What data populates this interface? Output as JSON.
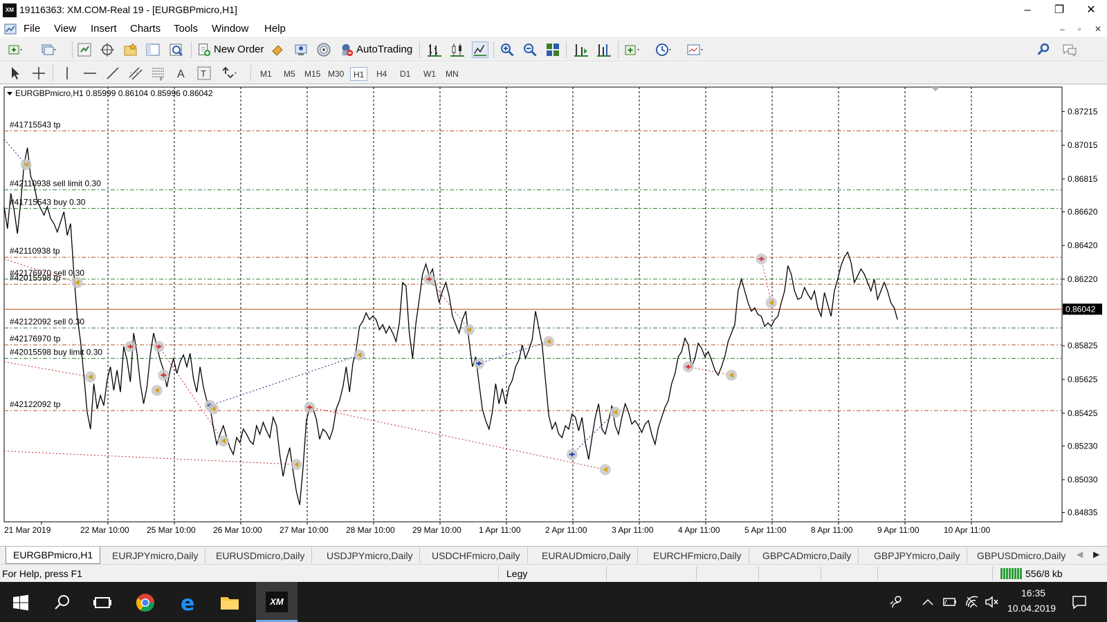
{
  "window": {
    "title": "19116363: XM.COM-Real 19 - [EURGBPmicro,H1]",
    "logo_text": "XM",
    "minimize": "–",
    "maximize": "❐",
    "close": "✕"
  },
  "menu": {
    "items": [
      "File",
      "View",
      "Insert",
      "Charts",
      "Tools",
      "Window",
      "Help"
    ],
    "mdi_min": "–",
    "mdi_restore": "▫",
    "mdi_close": "✕"
  },
  "toolbar": {
    "new_order": "New Order",
    "autotrading": "AutoTrading"
  },
  "timeframes": [
    "M1",
    "M5",
    "M15",
    "M30",
    "H1",
    "H4",
    "D1",
    "W1",
    "MN"
  ],
  "active_timeframe": "H1",
  "chart_data": {
    "type": "line",
    "symbol_info": "EURGBPmicro,H1  0.85999 0.86104 0.85996 0.86042",
    "current_price": "0.86042",
    "price_labels": [
      "0.87215",
      "0.87015",
      "0.86815",
      "0.86620",
      "0.86420",
      "0.86220",
      "0.86025",
      "0.85825",
      "0.85625",
      "0.85425",
      "0.85230",
      "0.85030",
      "0.84835"
    ],
    "time_labels": [
      "21 Mar 2019",
      "22 Mar 10:00",
      "25 Mar 10:00",
      "26 Mar 10:00",
      "27 Mar 10:00",
      "28 Mar 10:00",
      "29 Mar 10:00",
      "1 Apr 11:00",
      "2 Apr 11:00",
      "3 Apr 11:00",
      "4 Apr 11:00",
      "5 Apr 11:00",
      "8 Apr 11:00",
      "9 Apr 11:00",
      "10 Apr 11:00"
    ],
    "ylim": [
      0.8478,
      0.8736
    ],
    "order_lines": [
      {
        "label": "#41715543 tp",
        "price": 0.871,
        "color": "#b8501e",
        "kind": "tp"
      },
      {
        "label": "#42110938 sell limit 0.30",
        "price": 0.8675,
        "color": "#2e7d32",
        "kind": "order"
      },
      {
        "label": "#41715543 buy 0.30",
        "price": 0.8664,
        "color": "#2e7d32",
        "kind": "order"
      },
      {
        "label": "#42110938 tp",
        "price": 0.8635,
        "color": "#b8501e",
        "kind": "tp"
      },
      {
        "label": "#42176970 sell 0.30",
        "price": 0.8622,
        "color": "#2e7d32",
        "kind": "order"
      },
      {
        "label": "#42015598 tp",
        "price": 0.8619,
        "color": "#b8501e",
        "kind": "tp"
      },
      {
        "label": "#42122092 sell 0.30",
        "price": 0.8593,
        "color": "#2e7d32",
        "kind": "order"
      },
      {
        "label": "#42176970 tp",
        "price": 0.8583,
        "color": "#b8501e",
        "kind": "tp"
      },
      {
        "label": "#42015598 buy limit 0.30",
        "price": 0.8575,
        "color": "#2e7d32",
        "kind": "order"
      },
      {
        "label": "#42122092 tp",
        "price": 0.8544,
        "color": "#b8501e",
        "kind": "tp"
      }
    ],
    "price_series": [
      [
        0,
        0.8665
      ],
      [
        0.05,
        0.8652
      ],
      [
        0.1,
        0.8673
      ],
      [
        0.15,
        0.8663
      ],
      [
        0.2,
        0.8649
      ],
      [
        0.25,
        0.8668
      ],
      [
        0.3,
        0.869
      ],
      [
        0.35,
        0.87
      ],
      [
        0.4,
        0.8683
      ],
      [
        0.45,
        0.8678
      ],
      [
        0.5,
        0.8668
      ],
      [
        0.55,
        0.8664
      ],
      [
        0.6,
        0.866
      ],
      [
        0.65,
        0.8665
      ],
      [
        0.7,
        0.8658
      ],
      [
        0.75,
        0.8655
      ],
      [
        0.8,
        0.865
      ],
      [
        0.85,
        0.8656
      ],
      [
        0.9,
        0.8662
      ],
      [
        0.95,
        0.8648
      ],
      [
        1.0,
        0.8655
      ],
      [
        1.05,
        0.8625
      ],
      [
        1.1,
        0.86
      ],
      [
        1.15,
        0.8585
      ],
      [
        1.2,
        0.8565
      ],
      [
        1.25,
        0.8543
      ],
      [
        1.3,
        0.8533
      ],
      [
        1.35,
        0.856
      ],
      [
        1.4,
        0.8545
      ],
      [
        1.45,
        0.8553
      ],
      [
        1.5,
        0.8547
      ],
      [
        1.55,
        0.8562
      ],
      [
        1.6,
        0.857
      ],
      [
        1.65,
        0.8556
      ],
      [
        1.7,
        0.8568
      ],
      [
        1.75,
        0.8555
      ],
      [
        1.8,
        0.8582
      ],
      [
        1.85,
        0.8574
      ],
      [
        1.9,
        0.8561
      ],
      [
        1.95,
        0.859
      ],
      [
        2.0,
        0.8578
      ],
      [
        2.05,
        0.856
      ],
      [
        2.1,
        0.8548
      ],
      [
        2.15,
        0.8558
      ],
      [
        2.2,
        0.8577
      ],
      [
        2.25,
        0.859
      ],
      [
        2.3,
        0.8582
      ],
      [
        2.35,
        0.8574
      ],
      [
        2.4,
        0.8568
      ],
      [
        2.45,
        0.8558
      ],
      [
        2.5,
        0.8568
      ],
      [
        2.55,
        0.8575
      ],
      [
        2.6,
        0.8566
      ],
      [
        2.65,
        0.8573
      ],
      [
        2.7,
        0.8577
      ],
      [
        2.75,
        0.857
      ],
      [
        2.8,
        0.8578
      ],
      [
        2.85,
        0.8563
      ],
      [
        2.9,
        0.8555
      ],
      [
        2.95,
        0.857
      ],
      [
        3.0,
        0.8558
      ],
      [
        3.05,
        0.855
      ],
      [
        3.1,
        0.8546
      ],
      [
        3.15,
        0.8534
      ],
      [
        3.2,
        0.8524
      ],
      [
        3.25,
        0.853
      ],
      [
        3.3,
        0.8535
      ],
      [
        3.35,
        0.8528
      ],
      [
        3.4,
        0.8522
      ],
      [
        3.45,
        0.8518
      ],
      [
        3.5,
        0.8528
      ],
      [
        3.55,
        0.8525
      ],
      [
        3.6,
        0.8533
      ],
      [
        3.65,
        0.853
      ],
      [
        3.7,
        0.8526
      ],
      [
        3.75,
        0.8524
      ],
      [
        3.8,
        0.8535
      ],
      [
        3.85,
        0.853
      ],
      [
        3.9,
        0.8537
      ],
      [
        3.95,
        0.8532
      ],
      [
        4.0,
        0.8528
      ],
      [
        4.05,
        0.854
      ],
      [
        4.1,
        0.8535
      ],
      [
        4.15,
        0.8518
      ],
      [
        4.2,
        0.8505
      ],
      [
        4.25,
        0.8515
      ],
      [
        4.3,
        0.8522
      ],
      [
        4.35,
        0.8508
      ],
      [
        4.4,
        0.8496
      ],
      [
        4.45,
        0.8488
      ],
      [
        4.5,
        0.851
      ],
      [
        4.55,
        0.8538
      ],
      [
        4.6,
        0.8546
      ],
      [
        4.65,
        0.8545
      ],
      [
        4.7,
        0.8539
      ],
      [
        4.75,
        0.8527
      ],
      [
        4.8,
        0.8533
      ],
      [
        4.85,
        0.8531
      ],
      [
        4.9,
        0.8527
      ],
      [
        4.95,
        0.8533
      ],
      [
        5.0,
        0.8545
      ],
      [
        5.05,
        0.855
      ],
      [
        5.1,
        0.8558
      ],
      [
        5.15,
        0.857
      ],
      [
        5.2,
        0.8555
      ],
      [
        5.25,
        0.8572
      ],
      [
        5.3,
        0.858
      ],
      [
        5.35,
        0.8594
      ],
      [
        5.4,
        0.8597
      ],
      [
        5.45,
        0.8602
      ],
      [
        5.5,
        0.8598
      ],
      [
        5.55,
        0.86
      ],
      [
        5.6,
        0.8598
      ],
      [
        5.65,
        0.8592
      ],
      [
        5.7,
        0.8595
      ],
      [
        5.75,
        0.859
      ],
      [
        5.8,
        0.8594
      ],
      [
        5.85,
        0.859
      ],
      [
        5.9,
        0.8585
      ],
      [
        5.95,
        0.8596
      ],
      [
        6.0,
        0.862
      ],
      [
        6.05,
        0.8618
      ],
      [
        6.1,
        0.859
      ],
      [
        6.15,
        0.8575
      ],
      [
        6.2,
        0.8596
      ],
      [
        6.25,
        0.861
      ],
      [
        6.3,
        0.8625
      ],
      [
        6.35,
        0.8631
      ],
      [
        6.4,
        0.8624
      ],
      [
        6.45,
        0.8628
      ],
      [
        6.5,
        0.8618
      ],
      [
        6.55,
        0.8608
      ],
      [
        6.6,
        0.8615
      ],
      [
        6.65,
        0.862
      ],
      [
        6.7,
        0.8612
      ],
      [
        6.75,
        0.86
      ],
      [
        6.8,
        0.8595
      ],
      [
        6.85,
        0.859
      ],
      [
        6.9,
        0.8598
      ],
      [
        6.95,
        0.8603
      ],
      [
        7.0,
        0.8585
      ],
      [
        7.05,
        0.857
      ],
      [
        7.1,
        0.8576
      ],
      [
        7.15,
        0.856
      ],
      [
        7.2,
        0.8545
      ],
      [
        7.25,
        0.8538
      ],
      [
        7.3,
        0.8533
      ],
      [
        7.35,
        0.8543
      ],
      [
        7.4,
        0.856
      ],
      [
        7.45,
        0.8548
      ],
      [
        7.5,
        0.8557
      ],
      [
        7.55,
        0.8548
      ],
      [
        7.6,
        0.8558
      ],
      [
        7.65,
        0.8562
      ],
      [
        7.7,
        0.857
      ],
      [
        7.75,
        0.8574
      ],
      [
        7.8,
        0.8583
      ],
      [
        7.85,
        0.8575
      ],
      [
        7.9,
        0.858
      ],
      [
        7.95,
        0.8586
      ],
      [
        8.0,
        0.8603
      ],
      [
        8.05,
        0.8593
      ],
      [
        8.1,
        0.8583
      ],
      [
        8.15,
        0.8562
      ],
      [
        8.2,
        0.8541
      ],
      [
        8.25,
        0.8533
      ],
      [
        8.3,
        0.8537
      ],
      [
        8.35,
        0.853
      ],
      [
        8.4,
        0.8528
      ],
      [
        8.45,
        0.8535
      ],
      [
        8.5,
        0.8533
      ],
      [
        8.55,
        0.8542
      ],
      [
        8.6,
        0.854
      ],
      [
        8.65,
        0.8532
      ],
      [
        8.7,
        0.854
      ],
      [
        8.75,
        0.8525
      ],
      [
        8.8,
        0.8515
      ],
      [
        8.85,
        0.8528
      ],
      [
        8.9,
        0.854
      ],
      [
        8.95,
        0.8548
      ],
      [
        9.0,
        0.8533
      ],
      [
        9.05,
        0.853
      ],
      [
        9.1,
        0.8538
      ],
      [
        9.15,
        0.8547
      ],
      [
        9.2,
        0.8535
      ],
      [
        9.25,
        0.853
      ],
      [
        9.3,
        0.854
      ],
      [
        9.35,
        0.8548
      ],
      [
        9.4,
        0.8543
      ],
      [
        9.45,
        0.8536
      ],
      [
        9.5,
        0.8538
      ],
      [
        9.55,
        0.8535
      ],
      [
        9.6,
        0.8531
      ],
      [
        9.65,
        0.8536
      ],
      [
        9.7,
        0.8538
      ],
      [
        9.75,
        0.853
      ],
      [
        9.8,
        0.8524
      ],
      [
        9.85,
        0.8534
      ],
      [
        9.9,
        0.854
      ],
      [
        9.95,
        0.8546
      ],
      [
        10.0,
        0.855
      ],
      [
        10.05,
        0.856
      ],
      [
        10.1,
        0.8566
      ],
      [
        10.15,
        0.8576
      ],
      [
        10.2,
        0.8579
      ],
      [
        10.25,
        0.8587
      ],
      [
        10.3,
        0.8583
      ],
      [
        10.35,
        0.857
      ],
      [
        10.4,
        0.8575
      ],
      [
        10.45,
        0.8584
      ],
      [
        10.5,
        0.8581
      ],
      [
        10.55,
        0.8576
      ],
      [
        10.6,
        0.8579
      ],
      [
        10.65,
        0.8574
      ],
      [
        10.7,
        0.8568
      ],
      [
        10.75,
        0.8565
      ],
      [
        10.8,
        0.857
      ],
      [
        10.85,
        0.8576
      ],
      [
        10.9,
        0.8585
      ],
      [
        10.95,
        0.859
      ],
      [
        11.0,
        0.8595
      ],
      [
        11.05,
        0.8615
      ],
      [
        11.1,
        0.8622
      ],
      [
        11.15,
        0.8615
      ],
      [
        11.2,
        0.8608
      ],
      [
        11.25,
        0.8603
      ],
      [
        11.3,
        0.8605
      ],
      [
        11.35,
        0.8601
      ],
      [
        11.4,
        0.86
      ],
      [
        11.45,
        0.8594
      ],
      [
        11.5,
        0.8596
      ],
      [
        11.55,
        0.8594
      ],
      [
        11.6,
        0.8598
      ],
      [
        11.65,
        0.86
      ],
      [
        11.7,
        0.8608
      ],
      [
        11.75,
        0.8615
      ],
      [
        11.8,
        0.863
      ],
      [
        11.85,
        0.8625
      ],
      [
        11.9,
        0.8615
      ],
      [
        11.95,
        0.861
      ],
      [
        12.0,
        0.8611
      ],
      [
        12.05,
        0.8617
      ],
      [
        12.1,
        0.8613
      ],
      [
        12.15,
        0.861
      ],
      [
        12.2,
        0.8615
      ],
      [
        12.25,
        0.8605
      ],
      [
        12.3,
        0.86
      ],
      [
        12.35,
        0.8614
      ],
      [
        12.4,
        0.8607
      ],
      [
        12.45,
        0.86
      ],
      [
        12.5,
        0.8615
      ],
      [
        12.55,
        0.8622
      ],
      [
        12.6,
        0.863
      ],
      [
        12.65,
        0.8635
      ],
      [
        12.7,
        0.8638
      ],
      [
        12.75,
        0.8632
      ],
      [
        12.8,
        0.862
      ],
      [
        12.85,
        0.8624
      ],
      [
        12.9,
        0.8628
      ],
      [
        12.95,
        0.8625
      ],
      [
        13.0,
        0.862
      ],
      [
        13.05,
        0.8615
      ],
      [
        13.1,
        0.8622
      ],
      [
        13.15,
        0.861
      ],
      [
        13.2,
        0.8615
      ],
      [
        13.25,
        0.862
      ],
      [
        13.3,
        0.8615
      ],
      [
        13.35,
        0.8608
      ],
      [
        13.4,
        0.8605
      ],
      [
        13.45,
        0.8598
      ]
    ],
    "markers": [
      {
        "x": 0.33,
        "y": 0.869,
        "kind": "close"
      },
      {
        "x": 1.1,
        "y": 0.862,
        "kind": "close"
      },
      {
        "x": 1.3,
        "y": 0.8564,
        "kind": "close"
      },
      {
        "x": 1.9,
        "y": 0.8582,
        "kind": "sell"
      },
      {
        "x": 2.3,
        "y": 0.8556,
        "kind": "close"
      },
      {
        "x": 2.4,
        "y": 0.8565,
        "kind": "sell"
      },
      {
        "x": 2.33,
        "y": 0.8582,
        "kind": "sell"
      },
      {
        "x": 3.1,
        "y": 0.8547,
        "kind": "buy"
      },
      {
        "x": 3.15,
        "y": 0.8545,
        "kind": "close"
      },
      {
        "x": 3.3,
        "y": 0.8526,
        "kind": "close"
      },
      {
        "x": 4.4,
        "y": 0.8512,
        "kind": "close"
      },
      {
        "x": 4.6,
        "y": 0.8546,
        "kind": "sell"
      },
      {
        "x": 5.35,
        "y": 0.8577,
        "kind": "close"
      },
      {
        "x": 6.4,
        "y": 0.8622,
        "kind": "sell"
      },
      {
        "x": 7.0,
        "y": 0.8592,
        "kind": "close"
      },
      {
        "x": 7.15,
        "y": 0.8572,
        "kind": "buy"
      },
      {
        "x": 8.2,
        "y": 0.8585,
        "kind": "close"
      },
      {
        "x": 8.55,
        "y": 0.8518,
        "kind": "buy"
      },
      {
        "x": 9.05,
        "y": 0.8509,
        "kind": "close"
      },
      {
        "x": 9.2,
        "y": 0.8543,
        "kind": "close"
      },
      {
        "x": 10.3,
        "y": 0.857,
        "kind": "sell"
      },
      {
        "x": 10.95,
        "y": 0.8565,
        "kind": "close"
      },
      {
        "x": 11.4,
        "y": 0.8634,
        "kind": "sell"
      },
      {
        "x": 11.55,
        "y": 0.8608,
        "kind": "close"
      }
    ],
    "trade_links": [
      {
        "from": [
          0,
          0.8705
        ],
        "to": [
          0.33,
          0.869
        ],
        "color": "#1a237e"
      },
      {
        "from": [
          0,
          0.8634
        ],
        "to": [
          1.1,
          0.862
        ],
        "color": "#c62828"
      },
      {
        "from": [
          0,
          0.8573
        ],
        "to": [
          1.3,
          0.8564
        ],
        "color": "#c62828"
      },
      {
        "from": [
          0,
          0.852
        ],
        "to": [
          4.4,
          0.8512
        ],
        "color": "#c62828"
      },
      {
        "from": [
          2.33,
          0.8582
        ],
        "to": [
          3.3,
          0.8526
        ],
        "color": "#c62828"
      },
      {
        "from": [
          3.1,
          0.8547
        ],
        "to": [
          5.35,
          0.8577
        ],
        "color": "#1a237e"
      },
      {
        "from": [
          4.6,
          0.8546
        ],
        "to": [
          9.05,
          0.8509
        ],
        "color": "#c62828"
      },
      {
        "from": [
          6.4,
          0.8622
        ],
        "to": [
          7.0,
          0.8592
        ],
        "color": "#c62828"
      },
      {
        "from": [
          7.15,
          0.8572
        ],
        "to": [
          8.2,
          0.8585
        ],
        "color": "#1a237e"
      },
      {
        "from": [
          8.55,
          0.8518
        ],
        "to": [
          9.2,
          0.8543
        ],
        "color": "#1a237e"
      },
      {
        "from": [
          10.3,
          0.857
        ],
        "to": [
          10.95,
          0.8565
        ],
        "color": "#c62828"
      },
      {
        "from": [
          11.4,
          0.8634
        ],
        "to": [
          11.55,
          0.8608
        ],
        "color": "#c62828"
      }
    ],
    "grid": true
  },
  "tabs": [
    "EURGBPmicro,H1",
    "EURJPYmicro,Daily",
    "EURUSDmicro,Daily",
    "USDJPYmicro,Daily",
    "USDCHFmicro,Daily",
    "EURAUDmicro,Daily",
    "EURCHFmicro,Daily",
    "GBPCADmicro,Daily",
    "GBPJPYmicro,Daily",
    "GBPUSDmicro,Daily"
  ],
  "active_tab": "EURGBPmicro,H1",
  "status": {
    "help": "For Help, press F1",
    "profile": "Legy",
    "traffic": "556/8 kb"
  },
  "taskbar": {
    "time": "16:35",
    "date": "10.04.2019"
  },
  "colors": {
    "tp_line": "#b8501e",
    "order_line": "#2e7d32",
    "price_line": "#000000",
    "bid_line": "#c0502a",
    "taskbar_bg": "#1b1b1b"
  }
}
